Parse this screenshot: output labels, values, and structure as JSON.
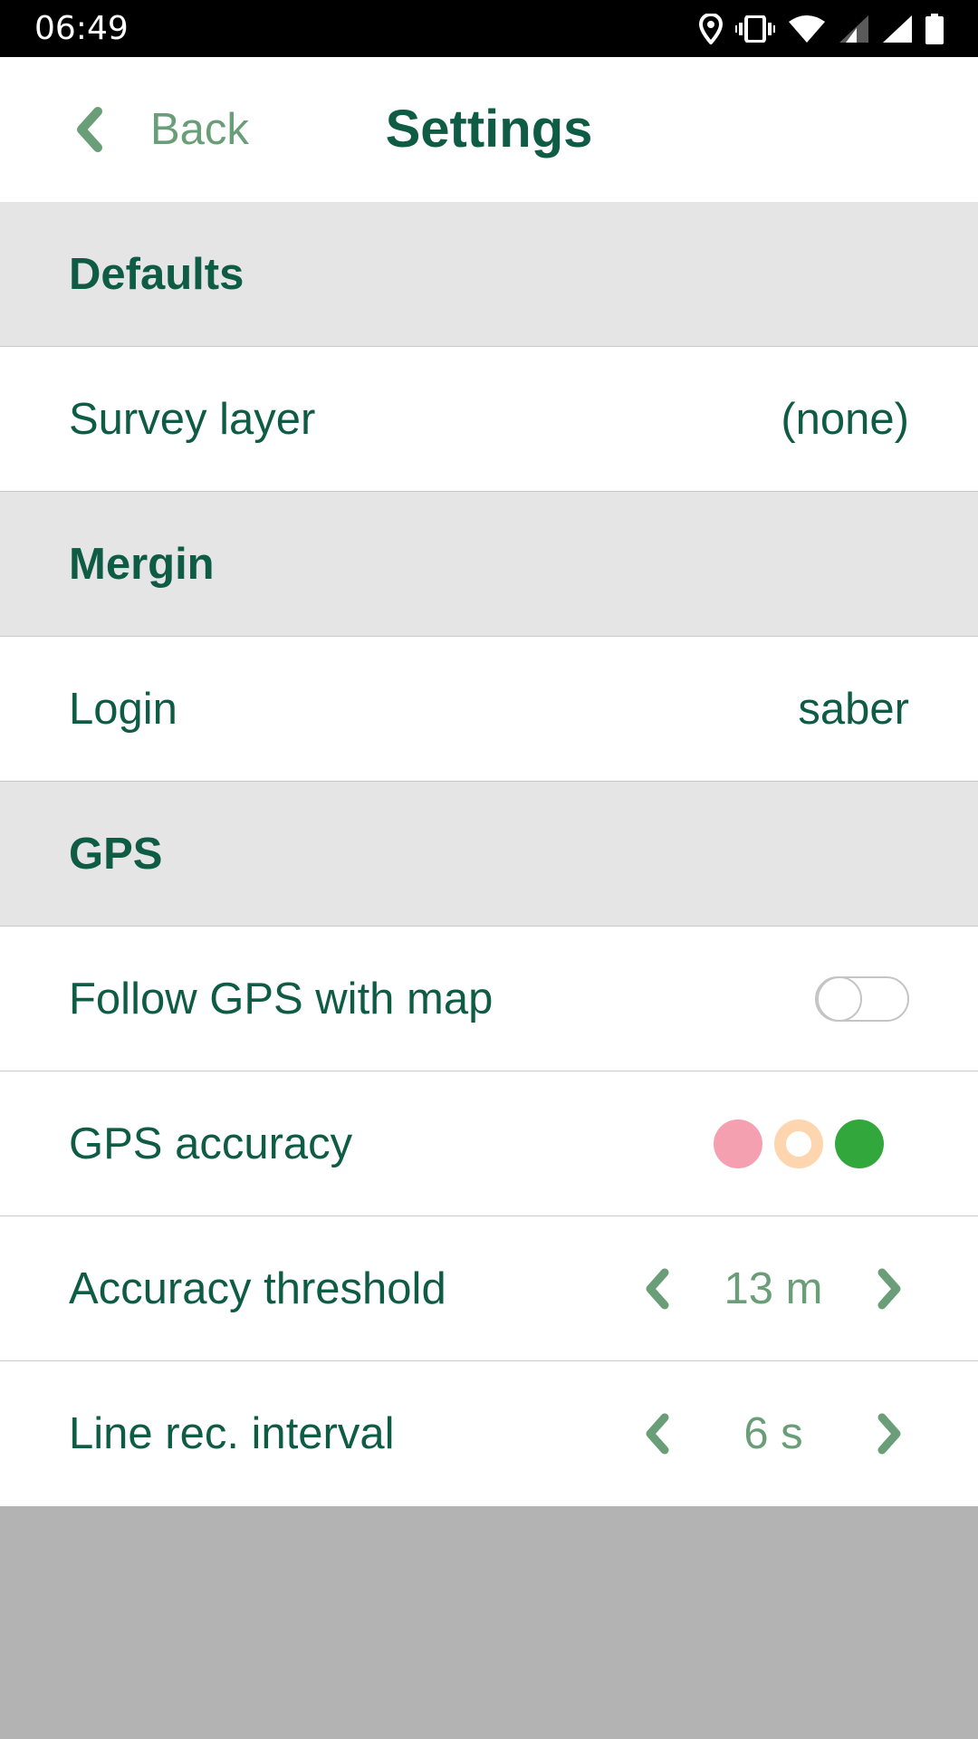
{
  "status_bar": {
    "time": "06:49",
    "icons": [
      "location-icon",
      "vibrate-icon",
      "wifi-icon",
      "signal-icon",
      "signal-icon",
      "battery-icon"
    ]
  },
  "header": {
    "back_label": "Back",
    "title": "Settings"
  },
  "sections": {
    "defaults": {
      "title": "Defaults",
      "survey_layer": {
        "label": "Survey layer",
        "value": "(none)"
      }
    },
    "mergin": {
      "title": "Mergin",
      "login": {
        "label": "Login",
        "value": "saber"
      }
    },
    "gps": {
      "title": "GPS",
      "follow_gps": {
        "label": "Follow GPS with map",
        "enabled": false
      },
      "gps_accuracy": {
        "label": "GPS accuracy",
        "indicators": [
          {
            "name": "low",
            "color": "#f5a0b1",
            "style": "filled"
          },
          {
            "name": "medium",
            "color": "#fdd6af",
            "style": "ring"
          },
          {
            "name": "high",
            "color": "#32a83c",
            "style": "filled"
          }
        ]
      },
      "accuracy_threshold": {
        "label": "Accuracy threshold",
        "value": "13 m"
      },
      "line_rec_interval": {
        "label": "Line rec. interval",
        "value": "6 s"
      }
    }
  },
  "colors": {
    "primary": "#0f5c45",
    "secondary": "#6a9e78",
    "section_bg": "#e5e5e5",
    "bottom_bg": "#b3b3b3"
  }
}
